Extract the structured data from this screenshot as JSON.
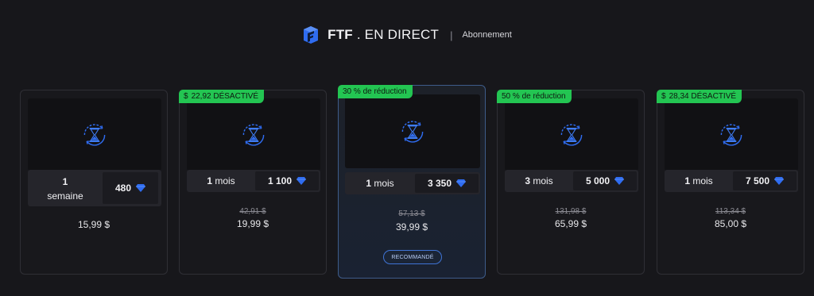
{
  "header": {
    "brand_bold": "FTF",
    "brand_rest": " . EN DIRECT",
    "separator": "|",
    "subtitle": "Abonnement"
  },
  "colors": {
    "background": "#17171b",
    "badge_green": "#23c552",
    "accent_blue": "#3f74d6",
    "gem_blue": "#2f6cf0"
  },
  "plans": [
    {
      "period_num": "1",
      "period_unit": "semaine",
      "gems": "480",
      "old_price": "",
      "price": "15,99 $",
      "badge": ""
    },
    {
      "period_num": "1",
      "period_unit": "mois",
      "gems": "1 100",
      "old_price": "42,91 $",
      "price": "19,99 $",
      "badge_icon": "$",
      "badge": "22,92 DÉSACTIVÉ"
    },
    {
      "period_num": "1",
      "period_unit": "mois",
      "gems": "3 350",
      "old_price": "57,13 $",
      "price": "39,99 $",
      "badge": "30 % de réduction",
      "recommended_label": "RECOMMANDÉ"
    },
    {
      "period_num": "3",
      "period_unit": "mois",
      "gems": "5 000",
      "old_price": "131,98 $",
      "price": "65,99 $",
      "badge": "50 % de réduction"
    },
    {
      "period_num": "1",
      "period_unit": "mois",
      "gems": "7 500",
      "old_price": "113,34 $",
      "price": "85,00 $",
      "badge_icon": "$",
      "badge": "28,34 DÉSACTIVÉ"
    }
  ]
}
